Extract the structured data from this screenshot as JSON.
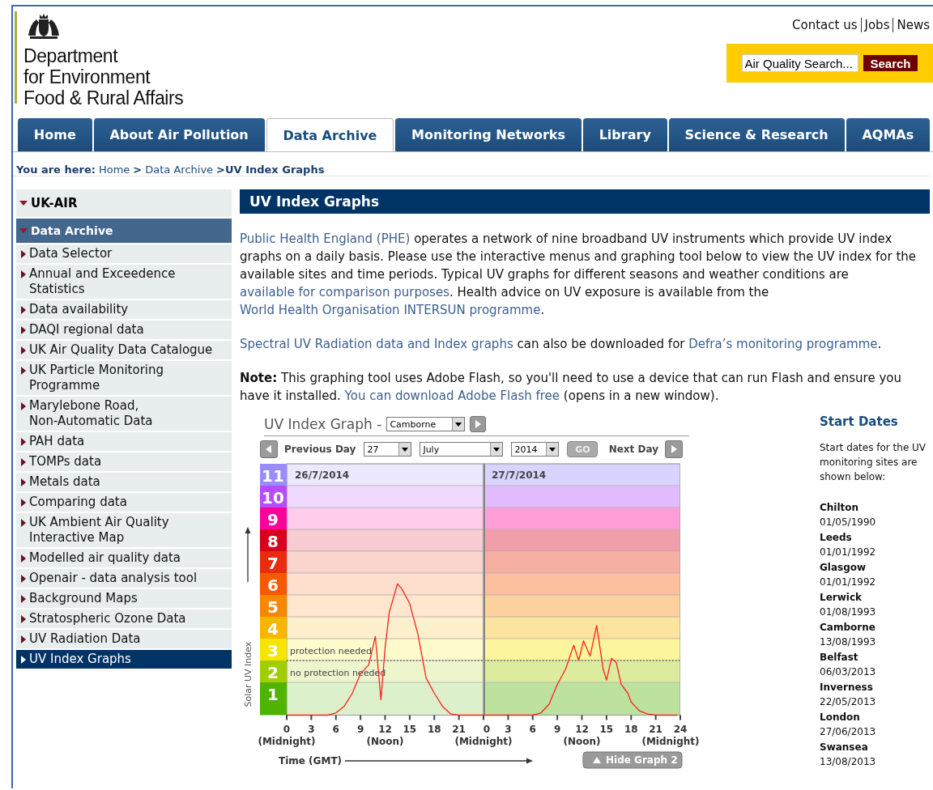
{
  "header": {
    "org_lines": [
      "Department",
      "for Environment",
      "Food & Rural Affairs"
    ],
    "top_links": [
      "Contact us",
      "Jobs",
      "News"
    ],
    "search": {
      "placeholder": "Air Quality Search...",
      "button": "Search"
    }
  },
  "tabs": [
    {
      "label": "Home",
      "selected": false
    },
    {
      "label": "About Air Pollution",
      "selected": false
    },
    {
      "label": "Data Archive",
      "selected": true
    },
    {
      "label": "Monitoring Networks",
      "selected": false
    },
    {
      "label": "Library",
      "selected": false
    },
    {
      "label": "Science & Research",
      "selected": false
    },
    {
      "label": "AQMAs",
      "selected": false
    }
  ],
  "breadcrumb": {
    "prefix": "You are here:",
    "links": [
      "Home",
      "Data Archive"
    ],
    "separator": ">",
    "current": ">UV Index Graphs"
  },
  "sidebar": {
    "title": {
      "label": "UK-AIR",
      "expanded": true
    },
    "section": {
      "label": "Data Archive",
      "expanded": true
    },
    "items": [
      {
        "label": "Data Selector",
        "selected": false
      },
      {
        "label": "Annual and Exceedence Statistics",
        "selected": false
      },
      {
        "label": "Data availability",
        "selected": false
      },
      {
        "label": "DAQI regional data",
        "selected": false
      },
      {
        "label": "UK Air Quality Data Catalogue",
        "selected": false
      },
      {
        "label": "UK Particle Monitoring Programme",
        "selected": false
      },
      {
        "label": "Marylebone Road, Non-Automatic Data",
        "selected": false
      },
      {
        "label": "PAH data",
        "selected": false
      },
      {
        "label": "TOMPs data",
        "selected": false
      },
      {
        "label": "Metals data",
        "selected": false
      },
      {
        "label": "Comparing data",
        "selected": false
      },
      {
        "label": "UK Ambient Air Quality Interactive Map",
        "selected": false
      },
      {
        "label": "Modelled air quality data",
        "selected": false
      },
      {
        "label": "Openair - data analysis tool",
        "selected": false
      },
      {
        "label": "Background Maps",
        "selected": false
      },
      {
        "label": "Stratospheric Ozone Data",
        "selected": false
      },
      {
        "label": "UV Radiation Data",
        "selected": false
      },
      {
        "label": "UV Index Graphs",
        "selected": true
      }
    ]
  },
  "main": {
    "heading": "UV Index Graphs",
    "paragraphs": [
      {
        "parts": [
          {
            "kind": "link",
            "text": "Public Health England (PHE)"
          },
          {
            "kind": "text",
            "text": " operates a network of nine broadband UV instruments which provide UV index graphs on a daily basis. Please use the interactive menus and graphing tool below to view the UV index for the available sites and time periods. Typical UV graphs for different seasons and weather conditions are "
          },
          {
            "kind": "link",
            "text": "available for comparison purposes"
          },
          {
            "kind": "text",
            "text": ". Health advice on UV exposure is available from the "
          },
          {
            "kind": "link",
            "text": "World Health Organisation INTERSUN programme"
          },
          {
            "kind": "text",
            "text": "."
          }
        ]
      },
      {
        "parts": [
          {
            "kind": "link",
            "text": "Spectral UV Radiation data and Index graphs"
          },
          {
            "kind": "text",
            "text": " can also be downloaded for "
          },
          {
            "kind": "link",
            "text": "Defra’s monitoring programme"
          },
          {
            "kind": "text",
            "text": "."
          }
        ]
      },
      {
        "parts": [
          {
            "kind": "text",
            "text": "**Note:** This graphing tool uses Adobe Flash, so you'll need to use a device that can run Flash and ensure you have it installed. "
          },
          {
            "kind": "link",
            "text": "You can download Adobe Flash free"
          },
          {
            "kind": "text",
            "text": " (opens in a new window)."
          }
        ]
      }
    ]
  },
  "graph": {
    "title": "UV Index Graph -",
    "site": "Camborne",
    "previous": "Previous Day",
    "next": "Next Day",
    "day": "27",
    "month": "July",
    "year": "2014",
    "go": "GO",
    "hide": "Hide Graph 2",
    "bands": [
      {
        "color": "#4eb400"
      },
      {
        "color": "#a0ce00"
      },
      {
        "color": "#f7e400"
      },
      {
        "color": "#f8b600"
      },
      {
        "color": "#f88700"
      },
      {
        "color": "#f85900"
      },
      {
        "color": "#e82c0e"
      },
      {
        "color": "#d8001d"
      },
      {
        "color": "#ff0099"
      },
      {
        "color": "#b54cff"
      },
      {
        "color": "#998cff"
      }
    ],
    "time_notes": [
      "(Midnight)",
      "(Noon)",
      "(Midnight)",
      "(Noon)",
      "(Midnight)"
    ],
    "axis_title": "Time (GMT)",
    "days": [
      {
        "chart_data": {
          "type": "line",
          "title": "26/7/2014",
          "ylabel": "Solar UV Index",
          "xlim": [
            0,
            24
          ],
          "ylim": [
            0,
            11.5
          ],
          "xticks": [
            0,
            3,
            6,
            9,
            12,
            15,
            18,
            21
          ],
          "yticks": [
            1,
            2,
            3,
            4,
            5,
            6,
            7,
            8,
            9,
            10,
            11
          ],
          "x": [
            0,
            3,
            5,
            6,
            7,
            8,
            9,
            10,
            10.8,
            11.5,
            12,
            12.5,
            13.5,
            14,
            15,
            16,
            17,
            18,
            19,
            20,
            21,
            24
          ],
          "series": [
            {
              "color": "#ff2020",
              "values": [
                0,
                0,
                0,
                0.1,
                0.4,
                1.0,
                1.9,
                2.3,
                3.6,
                0.7,
                3.1,
                4.7,
                6.0,
                5.8,
                5.1,
                3.7,
                1.7,
                1.0,
                0.4,
                0.05,
                0,
                0
              ]
            }
          ],
          "annotations": [
            "protection needed",
            "no protection needed"
          ]
        }
      },
      {
        "chart_data": {
          "type": "line",
          "title": "27/7/2014",
          "xlim": [
            0,
            24
          ],
          "ylim": [
            0,
            11.5
          ],
          "xticks": [
            0,
            3,
            6,
            9,
            12,
            15,
            18,
            21,
            24
          ],
          "x": [
            0,
            3,
            6,
            7,
            8,
            9,
            10,
            11,
            11.6,
            12.2,
            13,
            13.8,
            14.6,
            15,
            15.6,
            16.2,
            16.8,
            17.6,
            18,
            19,
            20,
            21,
            23.6
          ],
          "series": [
            {
              "color": "#ff2020",
              "values": [
                0,
                0,
                0,
                0.1,
                0.5,
                1.4,
                2.1,
                3.2,
                2.5,
                3.4,
                2.7,
                4.1,
                2.1,
                1.6,
                2.6,
                2.4,
                1.4,
                1.0,
                0.6,
                0.2,
                0.05,
                0,
                0
              ]
            }
          ]
        }
      }
    ]
  },
  "start_dates": {
    "title": "Start Dates",
    "intro": "Start dates for the UV monitoring sites are shown below:",
    "sites": [
      {
        "name": "Chilton",
        "date": "01/05/1990"
      },
      {
        "name": "Leeds",
        "date": "01/01/1992"
      },
      {
        "name": "Glasgow",
        "date": "01/01/1992"
      },
      {
        "name": "Lerwick",
        "date": "01/08/1993"
      },
      {
        "name": "Camborne",
        "date": "13/08/1993"
      },
      {
        "name": "Belfast",
        "date": "06/03/2013"
      },
      {
        "name": "Inverness",
        "date": "22/05/2013"
      },
      {
        "name": "London",
        "date": "27/06/2013"
      },
      {
        "name": "Swansea",
        "date": "13/08/2013"
      }
    ]
  }
}
